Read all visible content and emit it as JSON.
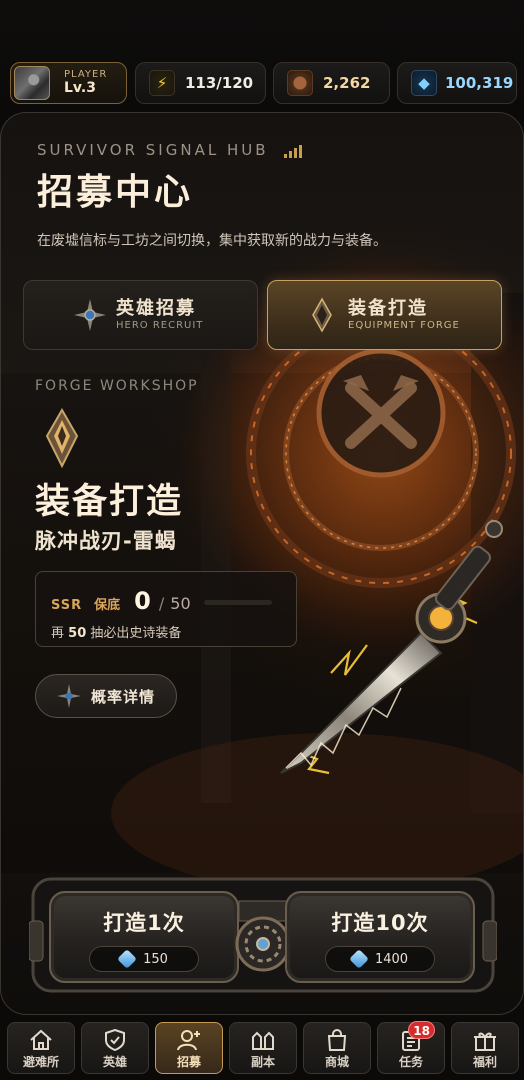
{
  "topbar": {
    "player": {
      "tag": "PLAYER",
      "level": "Lv.3"
    },
    "energy": {
      "value": "113/120",
      "icon": "lightning-icon"
    },
    "ore": {
      "value": "2,262",
      "icon": "ore-icon"
    },
    "gems": {
      "value": "100,319",
      "icon": "gem-icon"
    }
  },
  "hub": {
    "subtitle": "SURVIVOR SIGNAL HUB",
    "title": "招募中心",
    "description": "在废墟信标与工坊之间切换，集中获取新的战力与装备。"
  },
  "tabs": [
    {
      "cn": "英雄招募",
      "en": "HERO RECRUIT",
      "active": false
    },
    {
      "cn": "装备打造",
      "en": "EQUIPMENT FORGE",
      "active": true
    }
  ],
  "forge": {
    "section": "FORGE WORKSHOP",
    "title": "装备打造",
    "item_name": "脉冲战刃-雷蝎",
    "pity": {
      "tag": "SSR",
      "label": "保底",
      "current": "0",
      "slash": "/",
      "max": "50",
      "progress": 0,
      "hint_prefix": "再",
      "hint_count": "50",
      "hint_suffix": "抽必出史诗装备"
    },
    "rate_button": "概率详情"
  },
  "actions": {
    "single": {
      "label": "打造1次",
      "cost": "150"
    },
    "ten": {
      "label": "打造10次",
      "cost": "1400"
    }
  },
  "nav": [
    {
      "label": "避难所",
      "icon": "house-icon"
    },
    {
      "label": "英雄",
      "icon": "shield-icon"
    },
    {
      "label": "招募",
      "icon": "add-user-icon",
      "active": true
    },
    {
      "label": "副本",
      "icon": "dungeon-icon"
    },
    {
      "label": "商城",
      "icon": "shop-bag-icon"
    },
    {
      "label": "任务",
      "icon": "task-icon",
      "badge": "18"
    },
    {
      "label": "福利",
      "icon": "gift-icon"
    }
  ],
  "colors": {
    "accent_gold": "#c6a064",
    "badge_red": "#d52d2d",
    "gem_blue": "#9ad7ff"
  }
}
